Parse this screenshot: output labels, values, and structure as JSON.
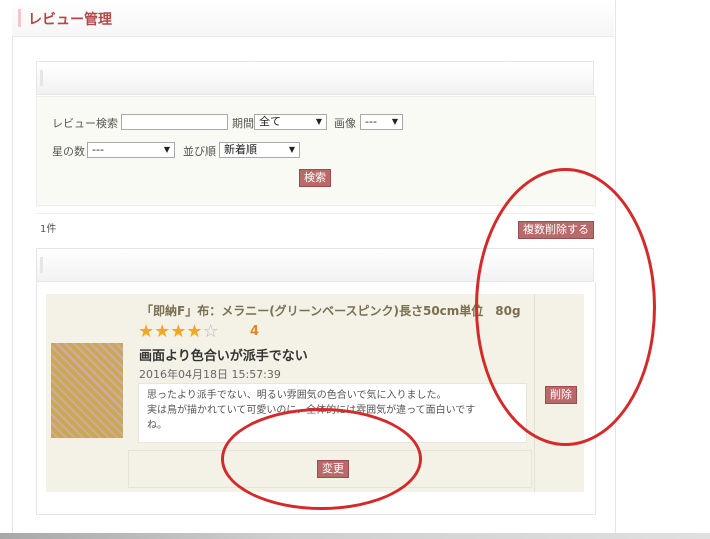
{
  "header": {
    "title": "レビュー管理"
  },
  "search": {
    "review_search_label": "レビュー検索",
    "review_search_value": "",
    "period_label": "期間",
    "period_value": "全て",
    "image_label": "画像",
    "image_value": "---",
    "stars_label": "星の数",
    "stars_value": "---",
    "sort_label": "並び順",
    "sort_value": "新着順",
    "search_button": "検索"
  },
  "results": {
    "count": "1件",
    "bulk_delete_button": "複数削除する"
  },
  "review": {
    "product": "「即納F」布：メラニー(グリーンベースピンク)長さ50cm単位　80g",
    "rating": 4,
    "rating_text": "4",
    "title": "画面より色合いが派手でない",
    "date": "2016年04月18日 15:57:39",
    "body_lines": [
      "思ったより派手でない、明るい雰囲気の色合いで気に入りました。",
      "実は鳥が描かれていて可愛いのに、全体的には雰囲気が違って面白いです",
      "ね。"
    ],
    "change_button": "変更",
    "delete_button": "削除"
  },
  "colors": {
    "accent": "#b86a6a",
    "title": "#b04a4a",
    "star": "#f0a828",
    "annotation": "#d42a2a"
  }
}
